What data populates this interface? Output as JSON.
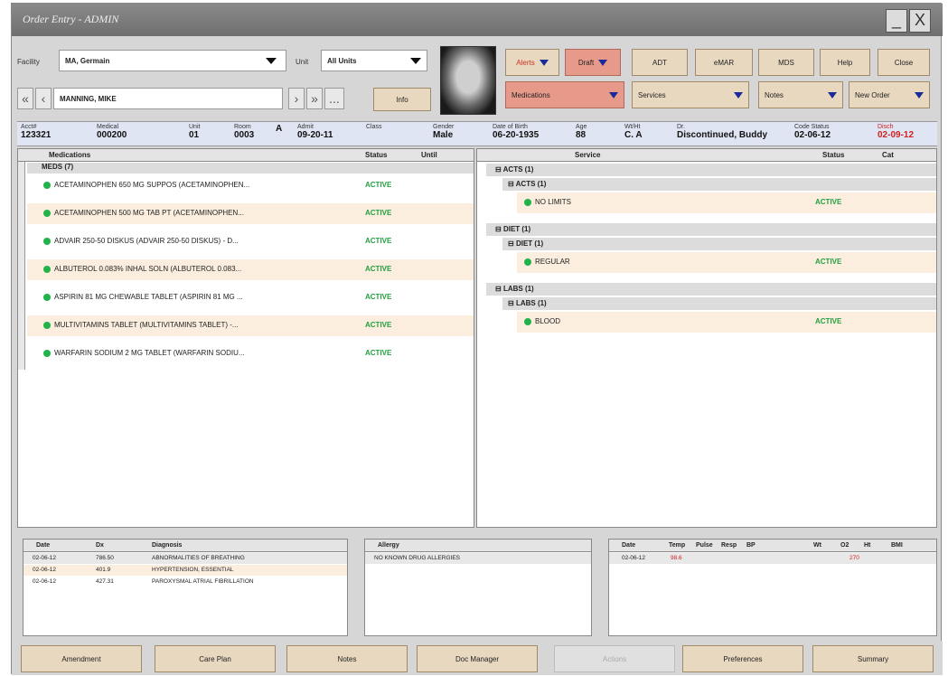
{
  "window": {
    "title": "Order Entry - ADMIN",
    "minimize": "_",
    "close": "X"
  },
  "facility": {
    "label": "Facility",
    "value": "MA, Germain"
  },
  "unit": {
    "label": "Unit",
    "value": "All Units"
  },
  "patient_search": {
    "value": "MANNING, MIKE",
    "info_button": "Info",
    "more_button": "..."
  },
  "top_buttons": {
    "alerts": "Alerts",
    "draft": "Draft",
    "adt": "ADT",
    "mar": "eMAR",
    "mds": "MDS",
    "help": "Help",
    "close": "Close"
  },
  "dropdowns": {
    "medications": "Medications",
    "services": "Services",
    "notes": "Notes",
    "new_order": "New Order"
  },
  "patient_bar": [
    {
      "label": "Acct#",
      "value": "123321"
    },
    {
      "label": "Medical",
      "value": "000200"
    },
    {
      "label": "Unit",
      "value": "01"
    },
    {
      "label": "Room",
      "value": "0003"
    },
    {
      "label": "",
      "value": "A"
    },
    {
      "label": "Admit",
      "value": "09-20-11"
    },
    {
      "label": "Class",
      "value": ""
    },
    {
      "label": "Gender",
      "value": "Male"
    },
    {
      "label": "Date of Birth",
      "value": "06-20-1935"
    },
    {
      "label": "Age",
      "value": "88"
    },
    {
      "label": "Wt/Ht",
      "value": "C. A"
    },
    {
      "label": "Dr.",
      "value": "Discontinued, Buddy"
    },
    {
      "label": "Code Status",
      "value": "02-06-12"
    },
    {
      "label": "Disch",
      "value": "02-09-12"
    }
  ],
  "medications_panel": {
    "columns": [
      "Medications",
      "Status",
      "Until"
    ],
    "group": "MEDS (7)",
    "rows": [
      {
        "name": "ACETAMINOPHEN 650 MG SUPPOS (ACETAMINOPHEN...",
        "status": "ACTIVE"
      },
      {
        "name": "ACETAMINOPHEN 500 MG TAB PT (ACETAMINOPHEN...",
        "status": "ACTIVE"
      },
      {
        "name": "ADVAIR 250-50 DISKUS (ADVAIR 250-50 DISKUS) - D...",
        "status": "ACTIVE"
      },
      {
        "name": "ALBUTEROL 0.083% INHAL SOLN (ALBUTEROL 0.083...",
        "status": "ACTIVE"
      },
      {
        "name": "ASPIRIN 81 MG CHEWABLE TABLET (ASPIRIN 81 MG ...",
        "status": "ACTIVE"
      },
      {
        "name": "MULTIVITAMINS TABLET (MULTIVITAMINS TABLET) -...",
        "status": "ACTIVE"
      },
      {
        "name": "WARFARIN SODIUM 2 MG TABLET (WARFARIN SODIU...",
        "status": "ACTIVE"
      }
    ]
  },
  "services_panel": {
    "columns": [
      "Service",
      "Status",
      "Cat"
    ],
    "groups": [
      {
        "title": "ACTS (1)",
        "sub": "ACTS (1)",
        "item": "NO LIMITS",
        "status": "ACTIVE"
      },
      {
        "title": "DIET (1)",
        "sub": "DIET (1)",
        "item": "REGULAR",
        "status": "ACTIVE"
      },
      {
        "title": "LABS (1)",
        "sub": "LABS (1)",
        "item": "BLOOD",
        "status": "ACTIVE"
      }
    ]
  },
  "diagnosis_panel": {
    "columns": [
      "Date",
      "Dx",
      "Diagnosis"
    ],
    "rows": [
      {
        "date": "02-06-12",
        "dx": "786.50",
        "diagnosis": "ABNORMALITIES OF BREATHING"
      },
      {
        "date": "02-06-12",
        "dx": "401.9",
        "diagnosis": "HYPERTENSION, ESSENTIAL"
      },
      {
        "date": "02-06-12",
        "dx": "427.31",
        "diagnosis": "PAROXYSMAL ATRIAL FIBRILLATION"
      }
    ]
  },
  "allergy_panel": {
    "columns": [
      "Allergy"
    ],
    "rows": [
      "NO KNOWN DRUG ALLERGIES"
    ]
  },
  "vitals_panel": {
    "columns": [
      "Date",
      "Temp",
      "Pulse",
      "Resp",
      "BP",
      "Wt",
      "O2",
      "Ht",
      "BMI"
    ],
    "rows": [
      {
        "date": "02-06-12",
        "temp": "98.6",
        "o2": "270"
      }
    ]
  },
  "bottom_buttons": [
    "Amendment",
    "Care Plan",
    "Notes",
    "Doc Manager",
    "Actions",
    "Preferences",
    "Summary"
  ]
}
